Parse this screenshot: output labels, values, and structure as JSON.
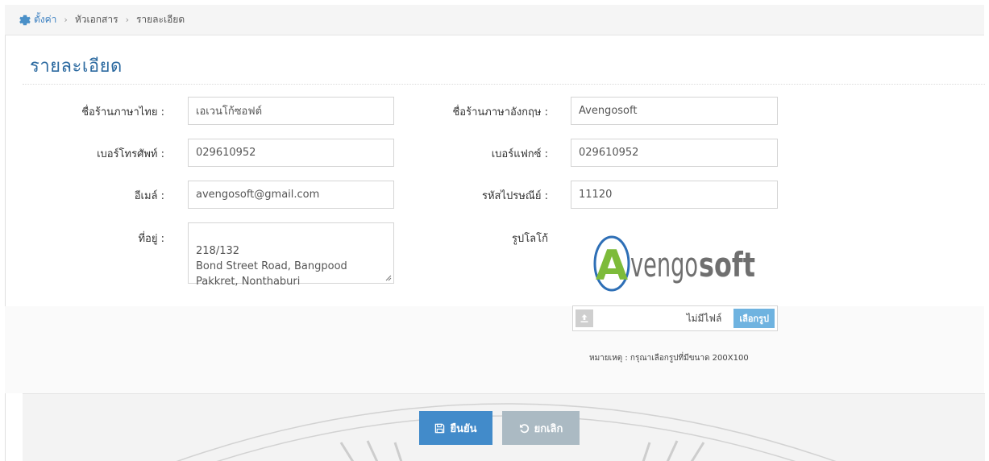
{
  "breadcrumb": {
    "items": [
      "ตั้งค่า",
      "หัวเอกสาร",
      "รายละเอียด"
    ]
  },
  "page_title": "รายละเอียด",
  "form": {
    "shop_name_th": {
      "label": "ชื่อร้านภาษาไทย :",
      "value": "เอเวนโก้ซอฟต์"
    },
    "shop_name_en": {
      "label": "ชื่อร้านภาษาอังกฤษ :",
      "value": "Avengosoft"
    },
    "phone": {
      "label": "เบอร์โทรศัพท์ :",
      "value": "029610952"
    },
    "fax": {
      "label": "เบอร์แฟกซ์ :",
      "value": "029610952"
    },
    "email": {
      "label": "อีเมล์ :",
      "value": "avengosoft@gmail.com"
    },
    "postal_code": {
      "label": "รหัสไปรษณีย์ :",
      "value": "11120"
    },
    "address": {
      "label": "ที่อยู่ :",
      "value": "218/132\nBond Street Road, Bangpood\nPakkret, Nonthaburi"
    },
    "logo": {
      "label": "รูปโลโก้",
      "brand_a": "A",
      "brand_thin": "vengo",
      "brand_bold": "soft"
    }
  },
  "file_picker": {
    "status": "ไม่มีไฟล์",
    "choose_label": "เลือกรูป"
  },
  "note": "หมายเหตุ : กรุณาเลือกรูปที่มีขนาด 200X100",
  "buttons": {
    "confirm": "ยืนยัน",
    "cancel": "ยกเลิก"
  },
  "colors": {
    "accent": "#428bca",
    "title": "#2c6aa0",
    "cancel": "#abbac3",
    "logo_green": "#7dbb3a",
    "logo_blue": "#2e6fb6",
    "logo_gray": "#6f6f6f"
  },
  "icons": [
    "gear-icon",
    "chevron-right-icon",
    "upload-icon",
    "save-icon",
    "undo-icon"
  ]
}
